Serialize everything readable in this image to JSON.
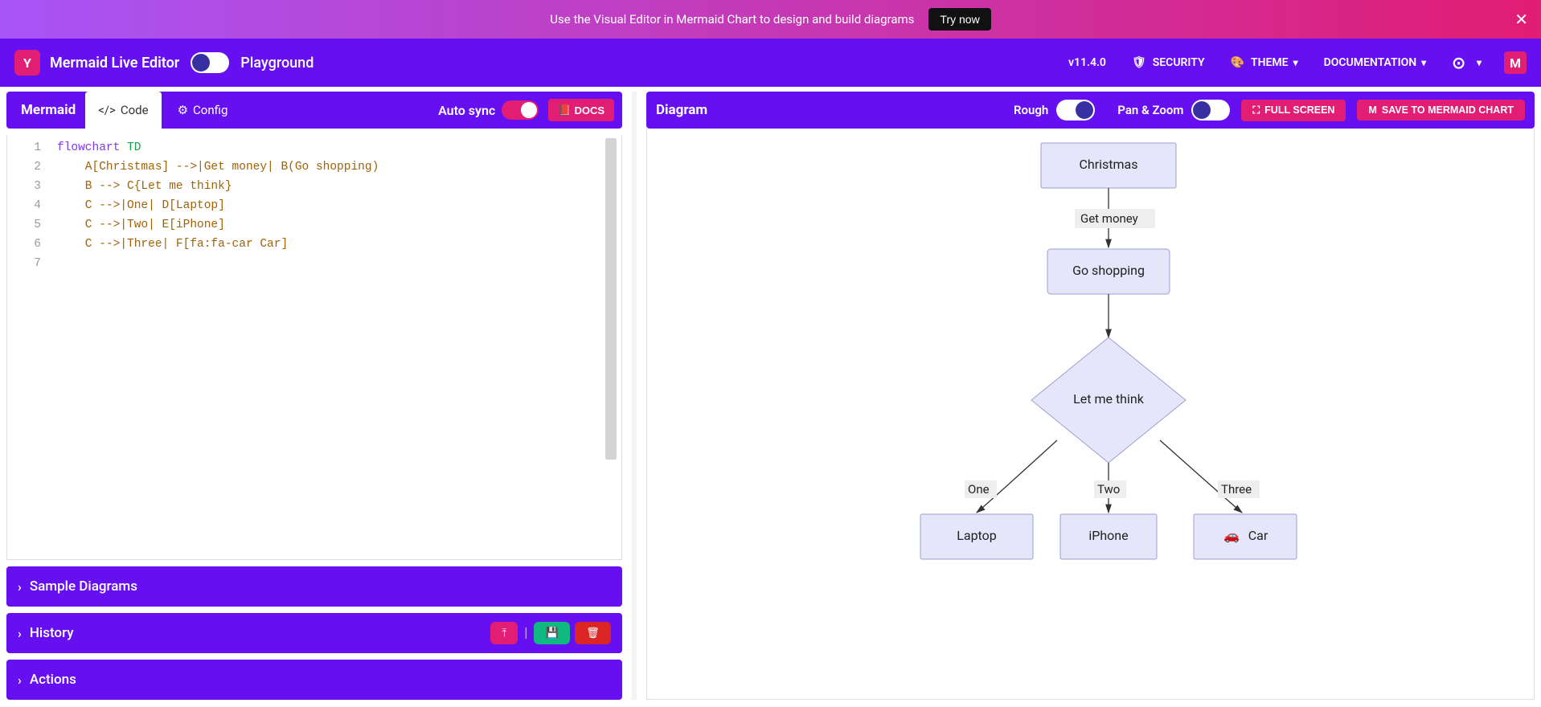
{
  "banner": {
    "text": "Use the Visual Editor in Mermaid Chart to design and build diagrams",
    "cta": "Try now"
  },
  "topbar": {
    "brand": "Mermaid Live Editor",
    "playground": "Playground",
    "version": "v11.4.0",
    "security": "SECURITY",
    "theme": "THEME",
    "documentation": "DOCUMENTATION"
  },
  "editor": {
    "mermaid_tab": "Mermaid",
    "code_tab": "Code",
    "config_tab": "Config",
    "autosync": "Auto sync",
    "docs": "DOCS",
    "lines": [
      "1",
      "2",
      "3",
      "4",
      "5",
      "6",
      "7"
    ],
    "code": {
      "l1a": "flowchart",
      "l1b": " TD",
      "l2": "    A[Christmas] -->|Get money| B(Go shopping)",
      "l3": "    B --> C{Let me think}",
      "l4": "    C -->|One| D[Laptop]",
      "l5": "    C -->|Two| E[iPhone]",
      "l6": "    C -->|Three| F[fa:fa-car Car]"
    }
  },
  "accordions": {
    "sample": "Sample Diagrams",
    "history": "History",
    "actions": "Actions"
  },
  "diagram": {
    "title": "Diagram",
    "rough": "Rough",
    "panzoom": "Pan & Zoom",
    "fullscreen": "FULL SCREEN",
    "save": "SAVE TO MERMAID CHART",
    "nodes": {
      "A": "Christmas",
      "B": "Go shopping",
      "C": "Let me think",
      "D": "Laptop",
      "E": "iPhone",
      "F": "Car"
    },
    "edges": {
      "AB": "Get money",
      "CD": "One",
      "CE": "Two",
      "CF": "Three"
    }
  }
}
